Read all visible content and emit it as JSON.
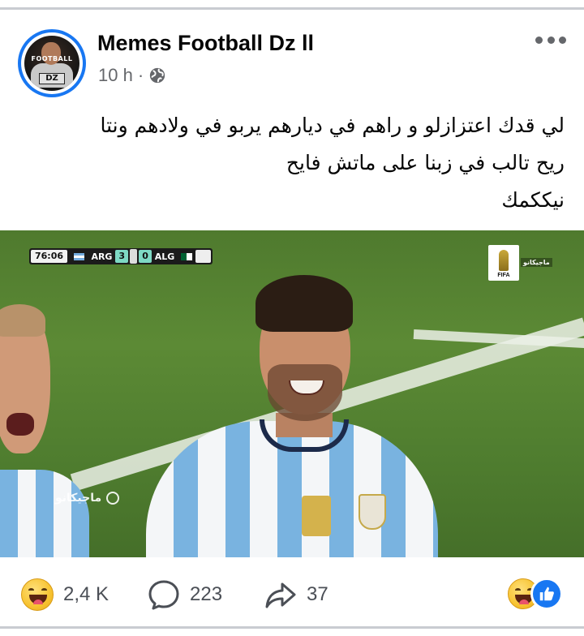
{
  "post": {
    "page_name": "Memes Football Dz ll",
    "time": "10 h",
    "separator": "·",
    "audience_icon": "globe-icon",
    "more_icon": "more-horizontal-icon",
    "caption_lines": [
      "لي قدك اعتزازلو و راهم في ديارهم يربو في ولادهم ونتا",
      "ريح تالب في زبنا على ماتش فايح",
      "نيككمك"
    ]
  },
  "avatar": {
    "text_top": "FOOTBALL",
    "text_bottom": "DZ"
  },
  "photo": {
    "scoreboard": {
      "clock": "76:06",
      "home_team": "ARG",
      "home_score": "3",
      "away_score": "0",
      "away_team": "ALG"
    },
    "broadcaster_tag": "ماجيكانو",
    "fifa_label": "FIFA",
    "watermark": "ماجيكانو"
  },
  "stats": {
    "reaction_count": "2,4 K",
    "reaction_icon": "laughing-emoji-icon",
    "comment_count": "223",
    "comment_icon": "comment-icon",
    "share_count": "37",
    "share_icon": "share-icon",
    "react_buttons": [
      "laughing-emoji-icon",
      "like-icon"
    ]
  },
  "colors": {
    "accent": "#1877f2",
    "text_primary": "#050505",
    "text_secondary": "#65676b",
    "divider": "#c9ccd1"
  }
}
